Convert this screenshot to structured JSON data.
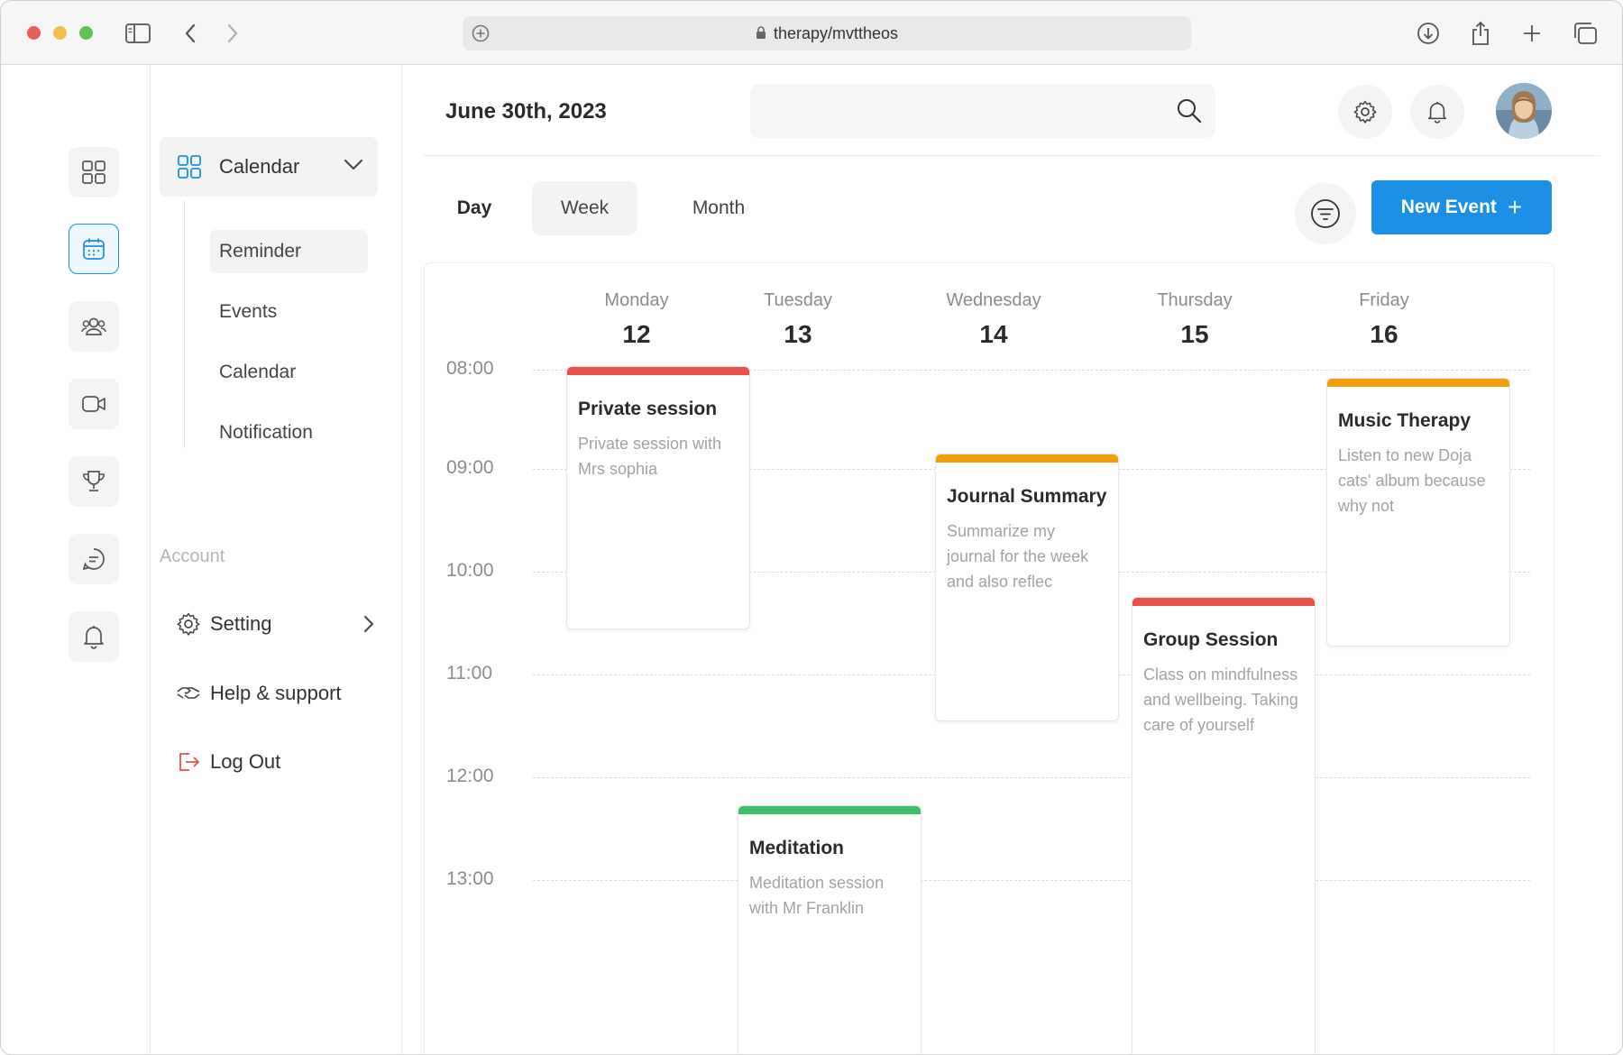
{
  "browser": {
    "url": "therapy/mvttheos"
  },
  "subnav": {
    "section_title": "Calendar",
    "items": [
      {
        "label": "Reminder",
        "active": true
      },
      {
        "label": "Events",
        "active": false
      },
      {
        "label": "Calendar",
        "active": false
      },
      {
        "label": "Notification",
        "active": false
      }
    ],
    "account_label": "Account",
    "account_items": [
      {
        "label": "Setting"
      },
      {
        "label": "Help & support"
      },
      {
        "label": "Log Out"
      }
    ]
  },
  "header": {
    "date": "June 30th, 2023",
    "search_placeholder": ""
  },
  "views": {
    "day": "Day",
    "week": "Week",
    "month": "Month",
    "active": "Week"
  },
  "new_event_label": "New Event",
  "calendar": {
    "days": [
      {
        "name": "Monday",
        "num": "12"
      },
      {
        "name": "Tuesday",
        "num": "13"
      },
      {
        "name": "Wednesday",
        "num": "14"
      },
      {
        "name": "Thursday",
        "num": "15"
      },
      {
        "name": "Friday",
        "num": "16"
      }
    ],
    "times": [
      "08:00",
      "09:00",
      "10:00",
      "11:00",
      "12:00",
      "13:00"
    ],
    "events": [
      {
        "title": "Private session",
        "desc": "Private session with Mrs sophia",
        "color": "#e9514a",
        "day": "Monday",
        "start": "08:00"
      },
      {
        "title": "Meditation",
        "desc": "Meditation session with Mr Franklin",
        "color": "#3dbf6b",
        "day": "Tuesday",
        "start": "12:00"
      },
      {
        "title": "Journal Summary",
        "desc": "Summarize my journal for the week and also reflec",
        "color": "#f29e0c",
        "day": "Wednesday",
        "start": "08:45"
      },
      {
        "title": "Group Session",
        "desc": "Class on mindfulness and wellbeing. Taking care of yourself",
        "color": "#e9514a",
        "day": "Thursday",
        "start": "10:00"
      },
      {
        "title": "Music Therapy",
        "desc": "Listen to new Doja cats' album because why not",
        "color": "#f29e0c",
        "day": "Friday",
        "start": "08:10"
      }
    ]
  },
  "colors": {
    "accent": "#1a8fe3",
    "logout": "#e9514a"
  }
}
